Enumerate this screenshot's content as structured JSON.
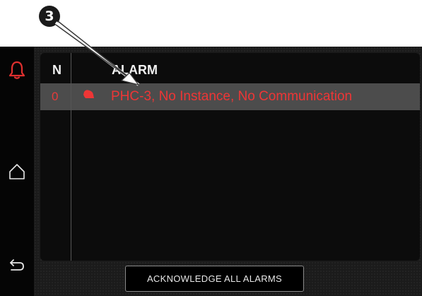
{
  "callout": {
    "number": "3"
  },
  "sidebar": {
    "items": [
      {
        "icon": "bell-icon",
        "active": true,
        "color": "#e0302f"
      },
      {
        "icon": "home-icon",
        "active": false
      },
      {
        "icon": "back-icon",
        "active": false
      }
    ]
  },
  "alarm_table": {
    "headers": {
      "number": "N",
      "alarm": "ALARM"
    },
    "rows": [
      {
        "n": "0",
        "icon": "alarm-bell-icon",
        "text": "PHC-3, No Instance, No Communication"
      }
    ]
  },
  "footer": {
    "ack_all_label": "ACKNOWLEDGE ALL ALARMS"
  },
  "colors": {
    "alarm_red": "#ee3636",
    "selected_row": "#4c4c4c",
    "background": "#1b1b1b"
  }
}
